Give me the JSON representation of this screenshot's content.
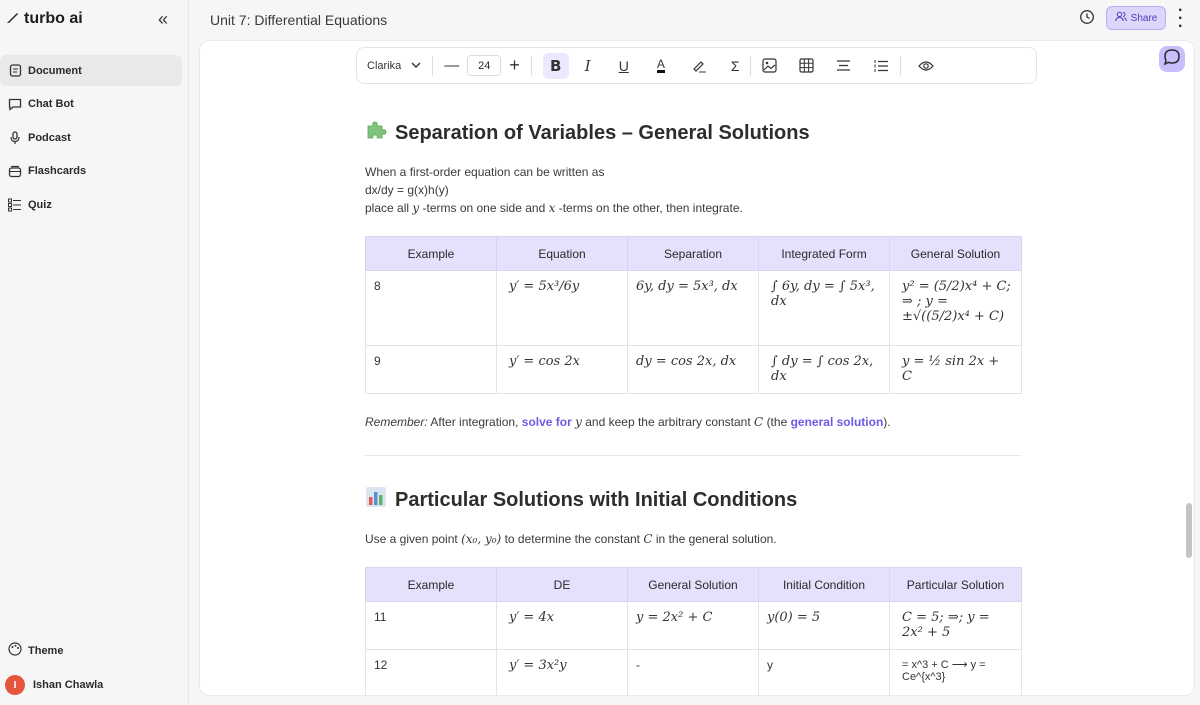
{
  "app": {
    "name": "turbo ai",
    "collapse_icon": "«"
  },
  "sidebar": {
    "items": [
      {
        "label": "Document",
        "icon": "document-icon",
        "active": true
      },
      {
        "label": "Chat Bot",
        "icon": "chat-icon"
      },
      {
        "label": "Podcast",
        "icon": "microphone-icon"
      },
      {
        "label": "Flashcards",
        "icon": "flashcards-icon"
      },
      {
        "label": "Quiz",
        "icon": "quiz-icon"
      }
    ],
    "theme_label": "Theme",
    "user": {
      "initial": "I",
      "name": "Ishan Chawla"
    }
  },
  "header": {
    "title": "Unit 7: Differential Equations",
    "share_label": "Share"
  },
  "toolbar": {
    "font": "Clarika",
    "font_size": "24"
  },
  "section1": {
    "title": "Separation of Variables – General Solutions",
    "line1": "When a first-order equation can be written as",
    "line2": "dx/dy = g(x)h(y)",
    "line3_a": "place all",
    "line3_y": "y",
    "line3_b": "-terms on one side and",
    "line3_x": "x",
    "line3_c": "-terms on the other, then integrate.",
    "table": {
      "headers": [
        "Example",
        "Equation",
        "Separation",
        "Integrated Form",
        "General Solution"
      ],
      "rows": [
        {
          "example": "8",
          "equation": "y′ = 5x³/6y",
          "separation": "6y, dy = 5x³, dx",
          "integrated": "∫ 6y, dy = ∫ 5x³, dx",
          "general": "y² = (5/2)x⁴ + C; ⇒ ; y = ±√((5/2)x⁴ + C)"
        },
        {
          "example": "9",
          "equation": "y′ = cos 2x",
          "separation": "dy = cos 2x, dx",
          "integrated": "∫ dy = ∫ cos 2x, dx",
          "general": "y = ½ sin 2x + C"
        }
      ]
    },
    "remember_a": "Remember:",
    "remember_b": " After integration,",
    "remember_link1": "solve for",
    "remember_y": "y",
    "remember_c": "and keep the arbitrary constant",
    "remember_C": "C",
    "remember_d": "(the",
    "remember_link2": "general solution",
    "remember_e": ")."
  },
  "section2": {
    "title": "Particular Solutions with Initial Conditions",
    "line_a": "Use a given point",
    "line_point": "(x₀, y₀)",
    "line_b": "to determine the constant",
    "line_C": "C",
    "line_c": "in the general solution.",
    "table": {
      "headers": [
        "Example",
        "DE",
        "General Solution",
        "Initial Condition",
        "Particular Solution"
      ],
      "rows": [
        {
          "example": "11",
          "de": "y′ = 4x",
          "general": "y = 2x² + C",
          "initial": "y(0) = 5",
          "particular": "C = 5; ⇒; y = 2x² + 5"
        },
        {
          "example": "12",
          "de": "y′ = 3x²y",
          "general": "-",
          "initial": "y",
          "particular": "= x^3 + C ⟶ y = Ce^{x^3}"
        }
      ]
    }
  },
  "colors": {
    "accent": "#6c5ce7",
    "header_bg": "#e6e0fc",
    "share_bg": "#dcd6fb",
    "avatar": "#e5543c"
  }
}
